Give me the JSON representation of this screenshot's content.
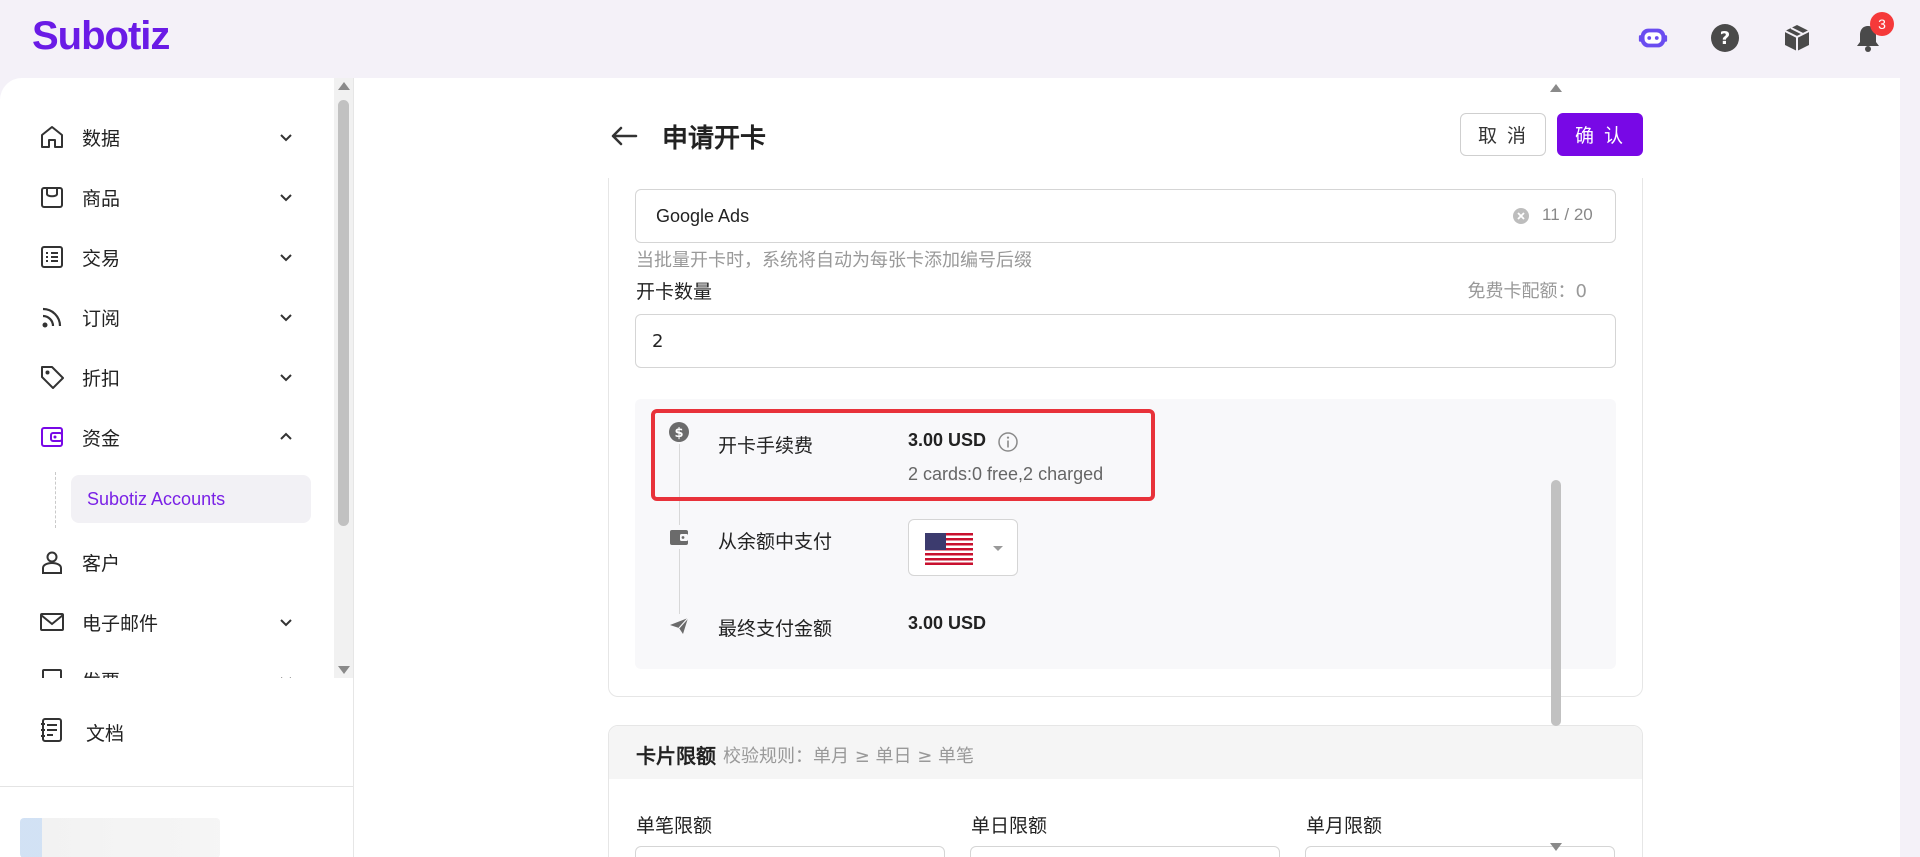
{
  "brand": {
    "name": "Subotiz",
    "color": "#6a1be6"
  },
  "header": {
    "icons": [
      "assistant-bot-icon",
      "help-icon",
      "package-icon",
      "bell-icon"
    ],
    "notification_count": "3"
  },
  "sidebar": {
    "items": [
      {
        "label": "数据",
        "icon": "home-icon"
      },
      {
        "label": "商品",
        "icon": "shop-icon"
      },
      {
        "label": "交易",
        "icon": "list-icon"
      },
      {
        "label": "订阅",
        "icon": "rss-icon"
      },
      {
        "label": "折扣",
        "icon": "tag-icon"
      },
      {
        "label": "资金",
        "icon": "wallet-icon",
        "expanded": true
      },
      {
        "label": "客户",
        "icon": "user-icon"
      },
      {
        "label": "电子邮件",
        "icon": "mail-icon"
      },
      {
        "label": "发票",
        "icon": "invoice-icon"
      }
    ],
    "sub_item": "Subotiz Accounts",
    "docs_label": "文档"
  },
  "page": {
    "title": "申请开卡",
    "cancel": "取 消",
    "confirm": "确 认"
  },
  "form": {
    "card_name_value": "Google Ads",
    "card_name_count": "11 / 20",
    "card_name_hint": "当批量开卡时，系统将自动为每张卡添加编号后缀",
    "quantity_label": "开卡数量",
    "free_quota": "免费卡配额：0",
    "quantity_value": "2"
  },
  "fee": {
    "fee_label": "开卡手续费",
    "fee_value": "3.00 USD",
    "fee_detail": "2 cards:0 free,2 charged",
    "pay_label": "从余额中支付",
    "currency": "USD",
    "total_label": "最终支付金额",
    "total_value": "3.00 USD"
  },
  "limits": {
    "title": "卡片限额",
    "rule": "校验规则：单月 ≥ 单日 ≥ 单笔",
    "per_txn": "单笔限额",
    "per_day": "单日限额",
    "per_month": "单月限额"
  },
  "colors": {
    "accent": "#7808e6",
    "highlight": "#e8323a",
    "badge": "#f5393a"
  }
}
